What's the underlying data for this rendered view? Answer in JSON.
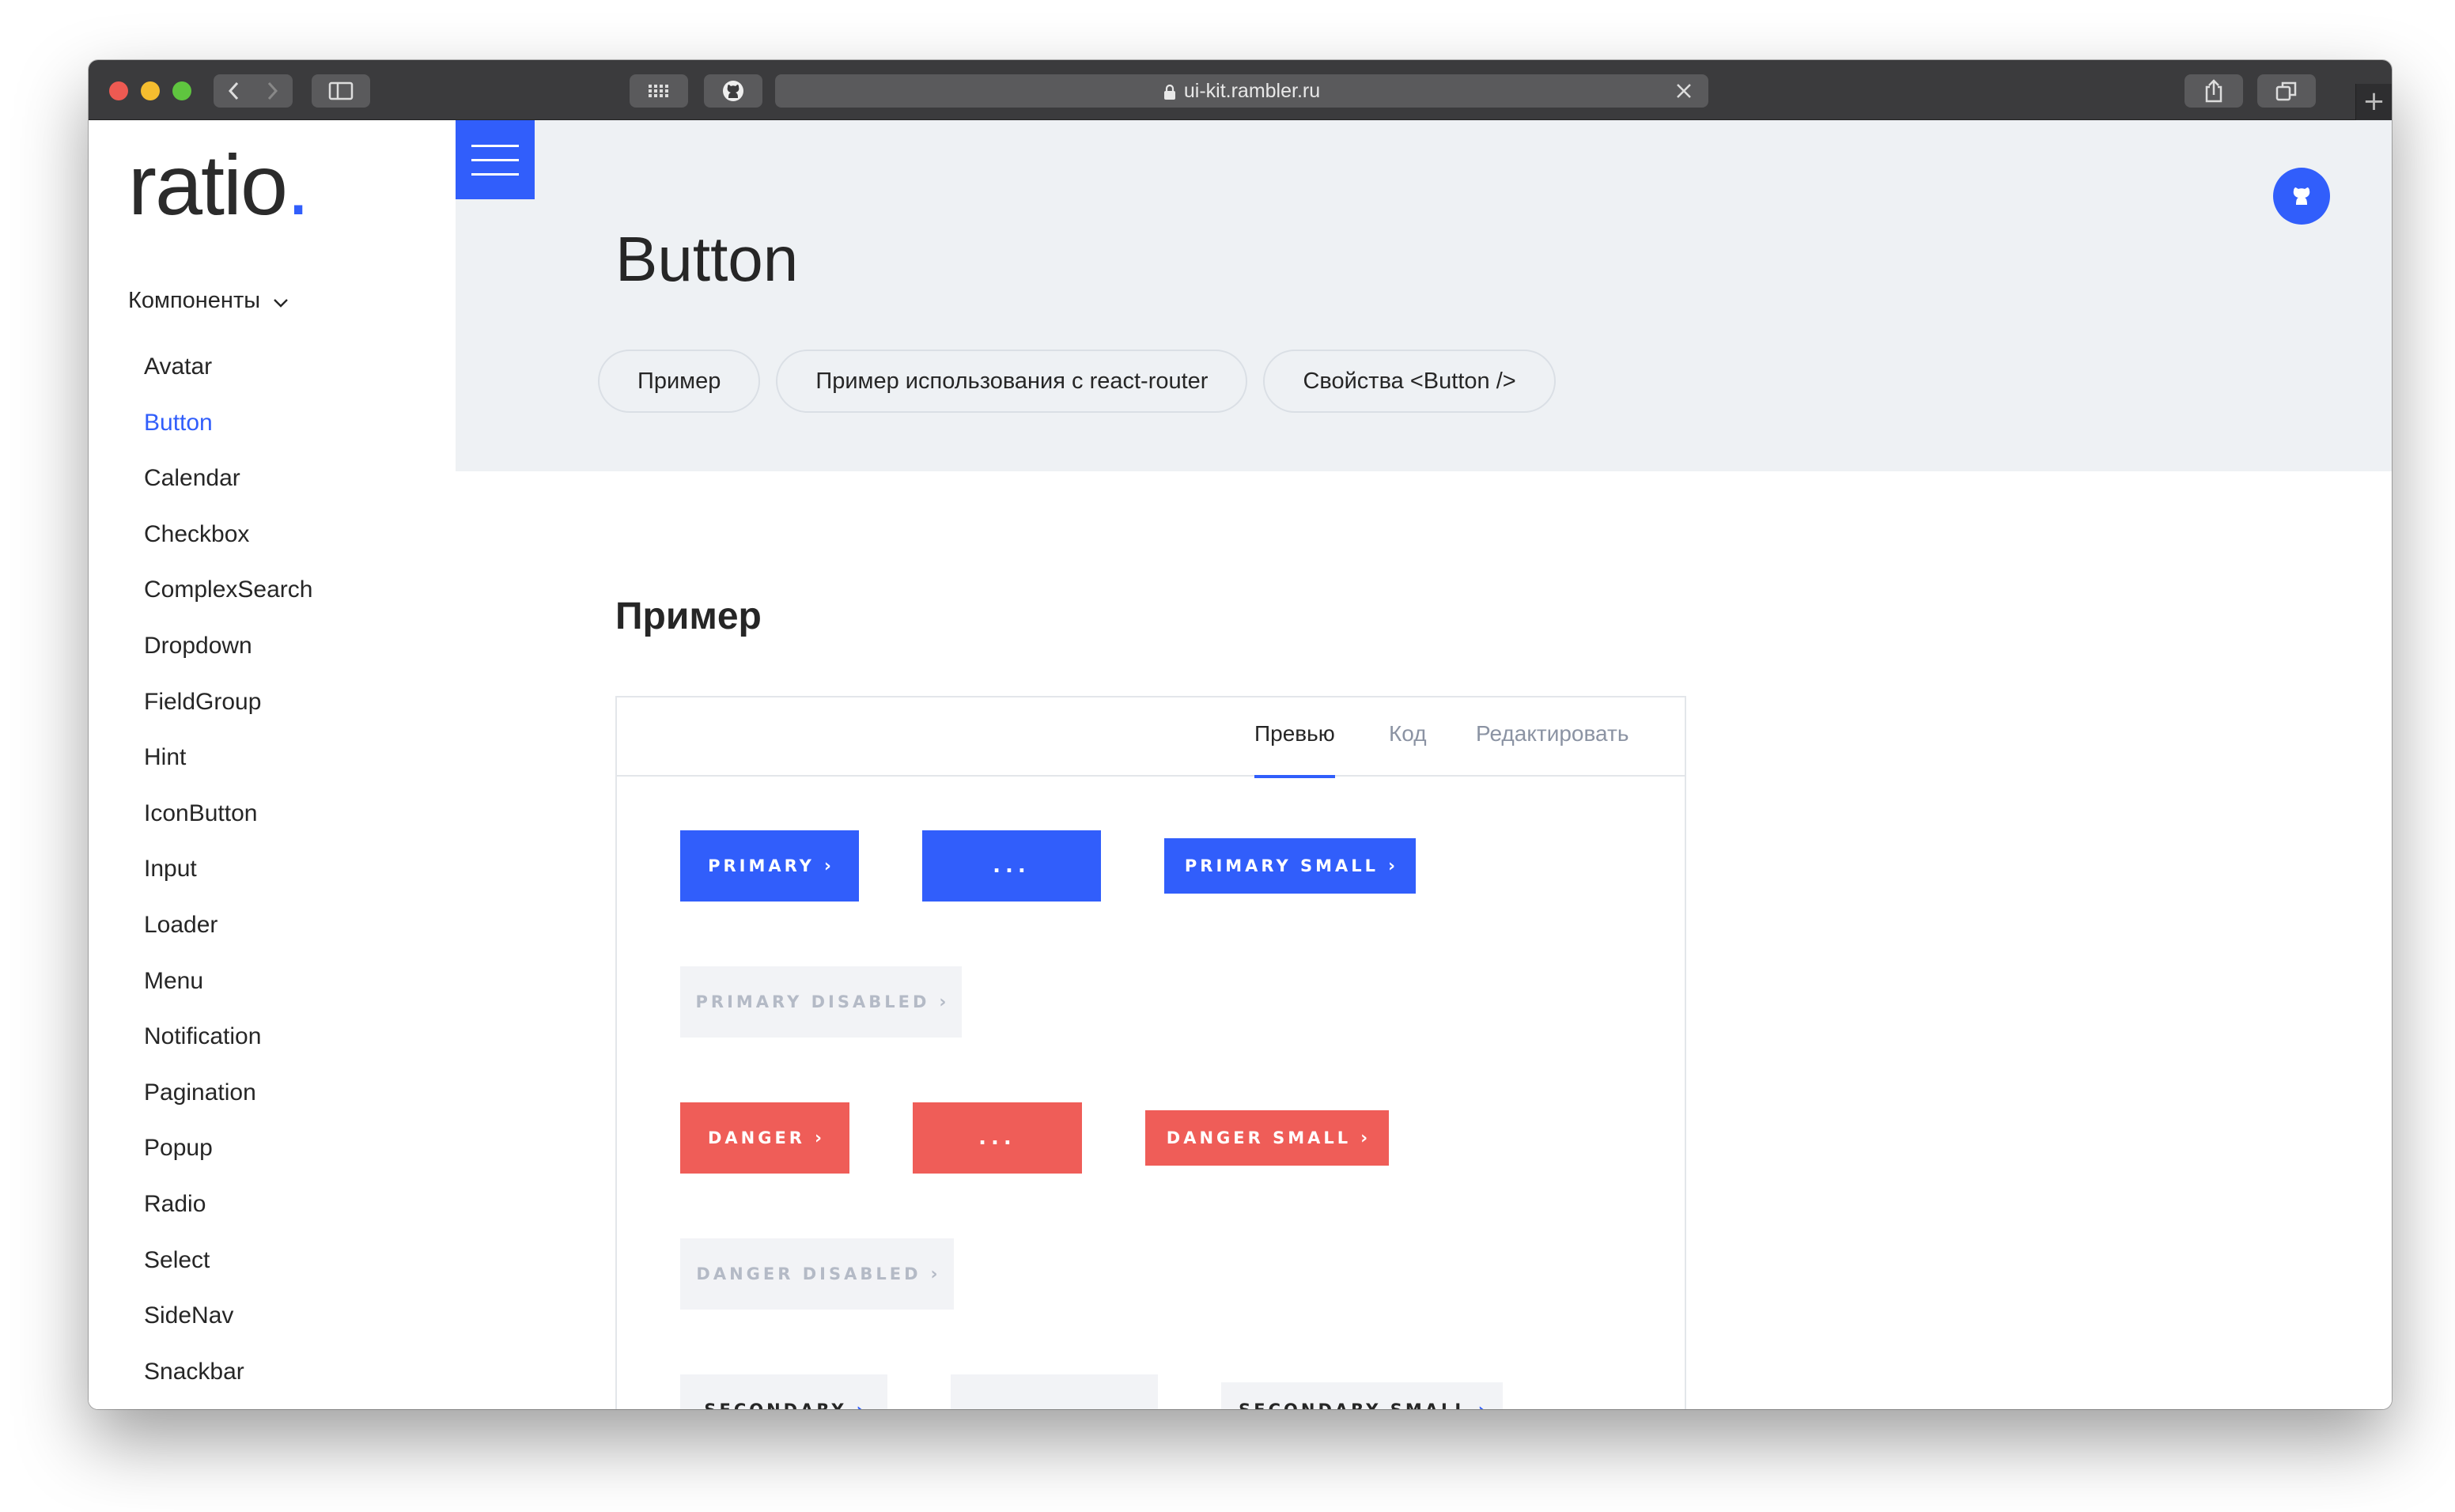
{
  "browser": {
    "url": "ui-kit.rambler.ru",
    "new_tab_label": "+"
  },
  "sidebar": {
    "logo_text": "ratio",
    "logo_dot": ".",
    "section_label": "Компоненты",
    "items": [
      {
        "label": "Avatar"
      },
      {
        "label": "Button"
      },
      {
        "label": "Calendar"
      },
      {
        "label": "Checkbox"
      },
      {
        "label": "ComplexSearch"
      },
      {
        "label": "Dropdown"
      },
      {
        "label": "FieldGroup"
      },
      {
        "label": "Hint"
      },
      {
        "label": "IconButton"
      },
      {
        "label": "Input"
      },
      {
        "label": "Loader"
      },
      {
        "label": "Menu"
      },
      {
        "label": "Notification"
      },
      {
        "label": "Pagination"
      },
      {
        "label": "Popup"
      },
      {
        "label": "Radio"
      },
      {
        "label": "Select"
      },
      {
        "label": "SideNav"
      },
      {
        "label": "Snackbar"
      }
    ],
    "active_item": "Button"
  },
  "header": {
    "title": "Button",
    "pills": [
      {
        "label": "Пример"
      },
      {
        "label": "Пример использования с react-router"
      },
      {
        "label": "Свойства <Button />"
      }
    ]
  },
  "section": {
    "title": "Пример"
  },
  "demo": {
    "tabs": [
      {
        "label": "Превью",
        "active": true
      },
      {
        "label": "Код",
        "active": false
      },
      {
        "label": "Редактировать",
        "active": false
      }
    ],
    "buttons": {
      "primary": "PRIMARY",
      "primary_loading": "...",
      "primary_small": "PRIMARY SMALL",
      "primary_disabled": "PRIMARY DISABLED",
      "danger": "DANGER",
      "danger_loading": "...",
      "danger_small": "DANGER SMALL",
      "danger_disabled": "DANGER DISABLED",
      "secondary": "SECONDARY",
      "secondary_small": "SECONDARY SMALL"
    },
    "chevron": "›"
  },
  "colors": {
    "accent": "#315efb",
    "danger": "#ef5d58",
    "hero_bg": "#eef1f4",
    "disabled_bg": "#f2f3f6"
  }
}
